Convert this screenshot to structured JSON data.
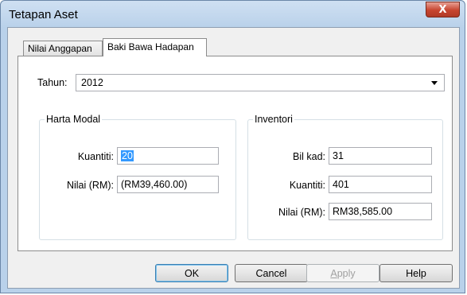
{
  "window": {
    "title": "Tetapan Aset",
    "close_glyph": "X"
  },
  "tabs": [
    {
      "label": "Nilai Anggapan",
      "active": false
    },
    {
      "label": "Baki Bawa Hadapan",
      "active": true
    }
  ],
  "year": {
    "label": "Tahun:",
    "value": "2012"
  },
  "harta_modal": {
    "title": "Harta Modal",
    "kuantiti_label": "Kuantiti:",
    "kuantiti_value": "20",
    "nilai_label": "Nilai (RM):",
    "nilai_value": "(RM39,460.00)"
  },
  "inventori": {
    "title": "Inventori",
    "bil_kad_label": "Bil kad:",
    "bil_kad_value": "31",
    "kuantiti_label": "Kuantiti:",
    "kuantiti_value": "401",
    "nilai_label": "Nilai (RM):",
    "nilai_value": "RM38,585.00"
  },
  "buttons": {
    "ok": "OK",
    "cancel": "Cancel",
    "apply_first": "A",
    "apply_rest": "pply",
    "help": "Help"
  },
  "colors": {
    "selection": "#3399ff",
    "window_frame": "#b9d1ea",
    "close": "#c7452f"
  }
}
